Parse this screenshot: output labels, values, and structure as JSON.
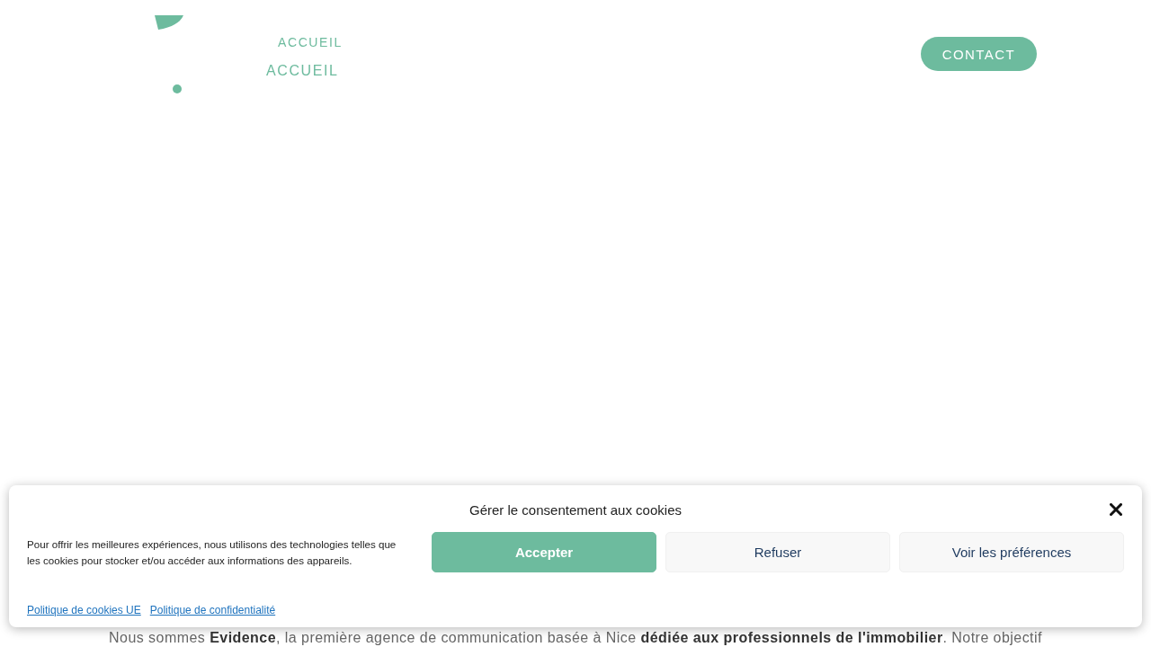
{
  "header": {
    "nav": [
      {
        "label": "ACCUEIL",
        "kind": "small"
      },
      {
        "label": "ACCUEIL",
        "kind": "large"
      }
    ],
    "contact_button": "CONTACT"
  },
  "cookie_banner": {
    "title": "Gérer le consentement aux cookies",
    "description": "Pour offrir les meilleures expériences, nous utilisons des technologies telles que les cookies pour stocker et/ou accéder aux informations des appareils.",
    "buttons": [
      {
        "label": "Accepter",
        "kind": "primary"
      },
      {
        "label": "Refuser",
        "kind": "secondary"
      },
      {
        "label": "Voir les préférences",
        "kind": "secondary"
      }
    ],
    "links": [
      "Politique de cookies UE",
      "Politique de confidentialité"
    ]
  },
  "intro_text": "Nous sommes **Evidence**, la première agence de communication basée à Nice **dédiée aux professionnels de l'immobilier**. Notre objectif"
}
